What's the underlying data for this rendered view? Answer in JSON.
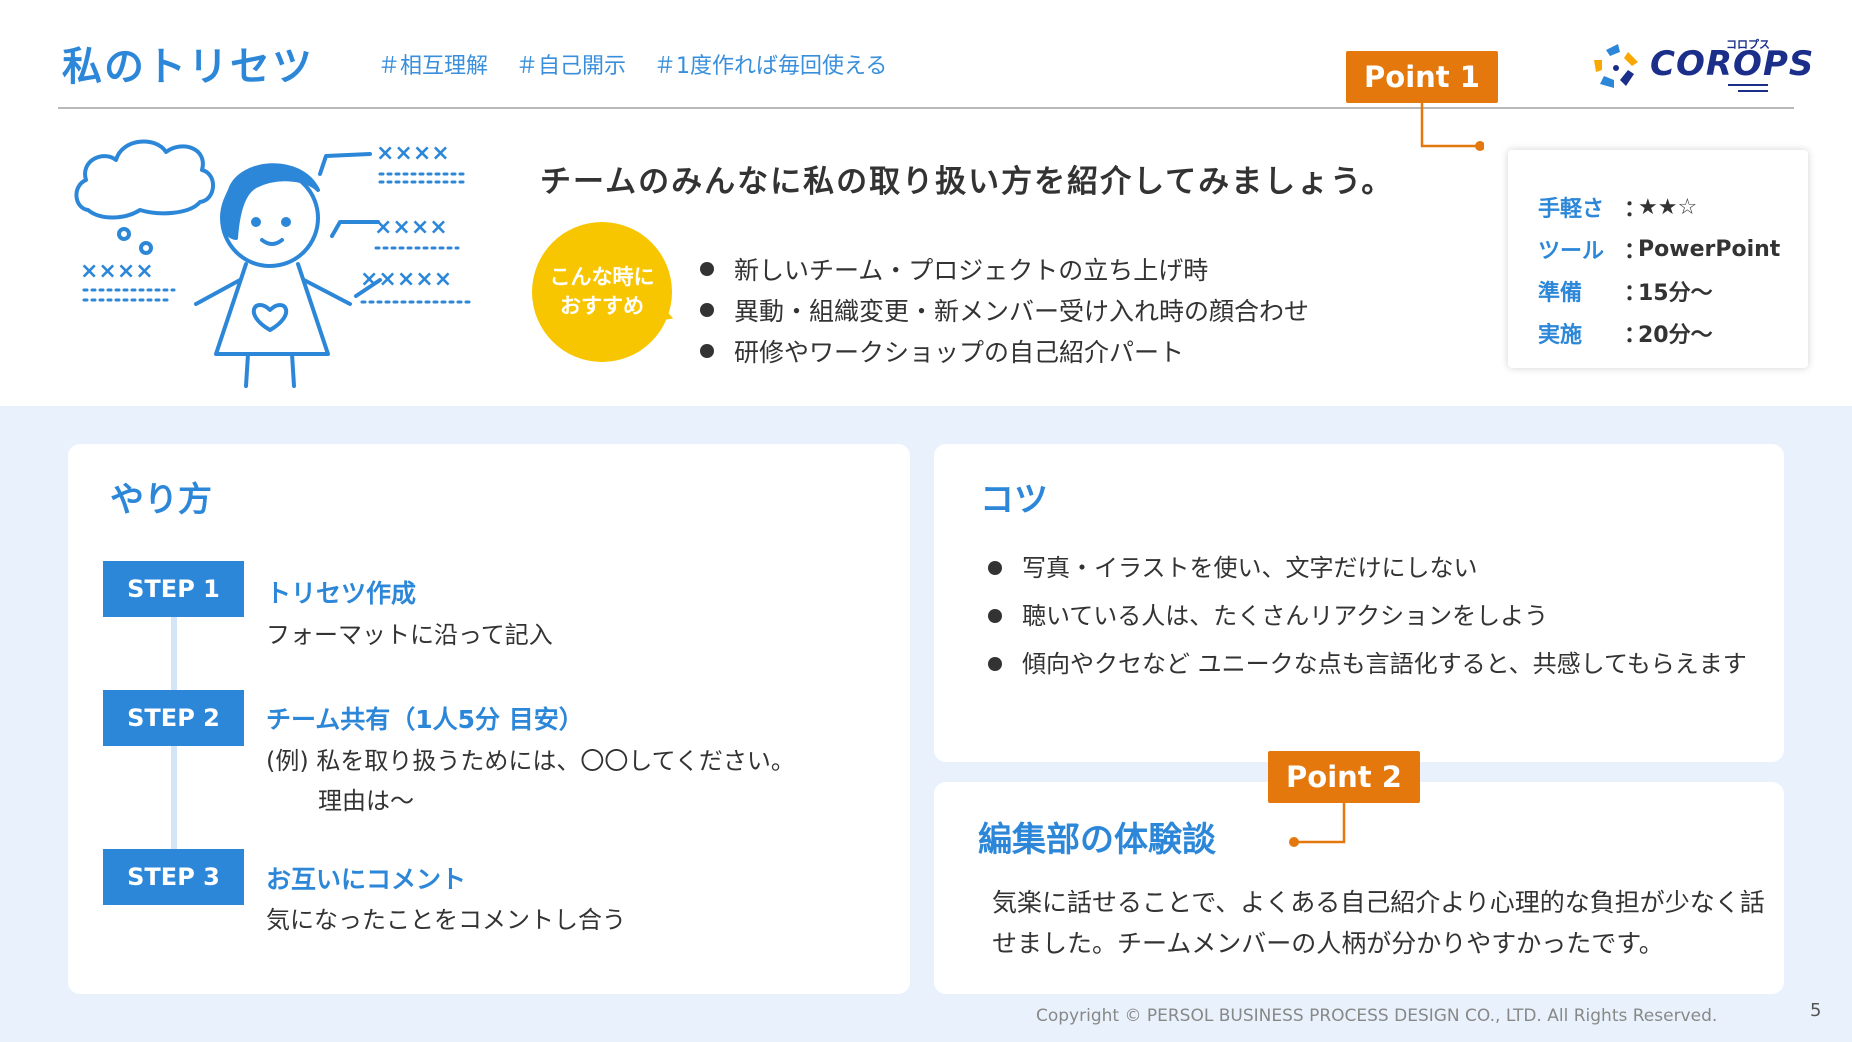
{
  "header": {
    "title": "私のトリセツ",
    "tags": [
      "＃相互理解",
      "＃自己開示",
      "＃1度作れば毎回使える"
    ]
  },
  "logo": {
    "kana": "コロプス",
    "text": "COROPS"
  },
  "points": {
    "point1": "Point 1",
    "point2": "Point 2"
  },
  "intro": {
    "lead": "チームのみんなに私の取り扱い方を紹介してみましょう。",
    "bubble_line1": "こんな時に",
    "bubble_line2": "おすすめ",
    "recommendations": [
      "新しいチーム・プロジェクトの立ち上げ時",
      "異動・組織変更・新メンバー受け入れ時の顔合わせ",
      "研修やワークショップの自己紹介パート"
    ]
  },
  "info": {
    "rows": [
      {
        "label": "手軽さ",
        "colon": "：",
        "value": "★★☆"
      },
      {
        "label": "ツール",
        "colon": "：",
        "value": "PowerPoint"
      },
      {
        "label": "準備",
        "colon": "：",
        "value": "15分〜"
      },
      {
        "label": "実施",
        "colon": "：",
        "value": "20分〜"
      }
    ]
  },
  "method": {
    "heading": "やり方",
    "steps": [
      {
        "badge": "STEP 1",
        "title": "トリセツ作成",
        "desc_line1": "フォーマットに沿って記入",
        "desc_line2": ""
      },
      {
        "badge": "STEP 2",
        "title": "チーム共有（1人5分 目安）",
        "desc_line1": "(例) 私を取り扱うためには、〇〇してください。",
        "desc_line2": "理由は〜"
      },
      {
        "badge": "STEP 3",
        "title": "お互いにコメント",
        "desc_line1": "気になったことをコメントし合う",
        "desc_line2": ""
      }
    ]
  },
  "tips": {
    "heading": "コツ",
    "items": [
      "写真・イラストを使い、文字だけにしない",
      "聴いている人は、たくさんリアクションをしよう",
      "傾向やクセなど ユニークな点も言語化すると、共感してもらえます"
    ]
  },
  "experience": {
    "heading": "編集部の体験談",
    "text": "気楽に話せることで、よくある自己紹介より心理的な負担が少なく話せました。チームメンバーの人柄が分かりやすかったです。"
  },
  "footer": {
    "copyright": "Copyright © PERSOL BUSINESS PROCESS DESIGN CO., LTD. All Rights Reserved.",
    "page": "5"
  },
  "colors": {
    "accent_blue": "#2d87d8",
    "orange": "#e4780c",
    "yellow": "#f8c600",
    "bottom_bg": "#e9f2fc",
    "logo_navy": "#1b2f8a"
  }
}
